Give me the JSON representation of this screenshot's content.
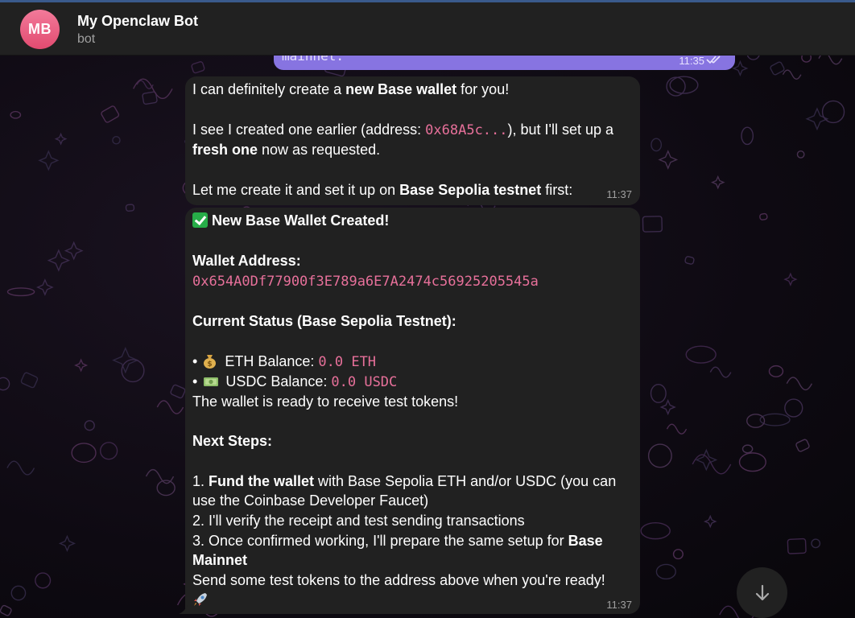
{
  "header": {
    "avatar_initials": "MB",
    "title": "My Openclaw Bot",
    "subtitle": "bot",
    "avatar_color": "#e8577c"
  },
  "outgoing": {
    "text_fragment": "mainnet.",
    "time": "11:35",
    "bubble_color": "#8774e1"
  },
  "message1": {
    "line1_pre": "I can definitely create a ",
    "line1_bold": "new Base wallet",
    "line1_post": " for you!",
    "line2_pre": "I see I created one earlier (address: ",
    "line2_code": "0x68A5c...",
    "line2_post": "), but I'll set up a",
    "line3_bold": "fresh one",
    "line3_post": " now as requested.",
    "line4_pre": "Let me create it and set it up on ",
    "line4_bold": "Base Sepolia testnet",
    "line4_post": " first:",
    "time": "11:37"
  },
  "message2": {
    "heading": "New Base Wallet Created!",
    "address_label": "Wallet Address:",
    "address": "0x654A0Df77900f3E789a6E7A2474c56925205545a",
    "status_label": "Current Status (Base Sepolia Testnet):",
    "bullet": "•",
    "eth_label": " ETH Balance: ",
    "eth_value": "0.0 ETH",
    "usdc_label": " USDC Balance: ",
    "usdc_value": "0.0 USDC",
    "ready_text": "The wallet is ready to receive test tokens!",
    "next_steps_label": "Next Steps:",
    "step1_num": "1. ",
    "step1_bold": "Fund the wallet",
    "step1_post": " with Base Sepolia ETH and/or USDC (you can",
    "step1_cont": "use the Coinbase Developer Faucet)",
    "step2": "2. I'll verify the receipt and test sending transactions",
    "step3_pre": "3. Once confirmed working, I'll prepare the same setup for ",
    "step3_bold1": "Base",
    "step3_bold2": "Mainnet",
    "closing": "Send some test tokens to the address above when you're ready!",
    "time": "11:37"
  },
  "icons": {
    "check": "white-check-mark-icon",
    "moneybag": "money-bag-icon",
    "cash": "dollar-banknote-icon",
    "rocket": "rocket-icon",
    "scroll": "arrow-down-icon"
  },
  "colors": {
    "accent_code": "#e7709a",
    "bubble_in": "#212121",
    "header_bg": "#212121"
  }
}
